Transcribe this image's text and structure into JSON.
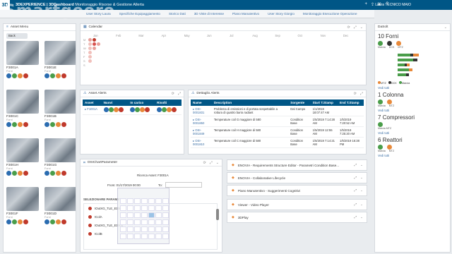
{
  "app": {
    "logo_letter": "3D",
    "title_prefix": "3DEXPERIENCE | 3DDashboard",
    "title_rest": "Monitoraggio Risorse & Gestione Allerta",
    "user": "Laura TECNICO MAIO",
    "watermark": "Smartgooro"
  },
  "tabs": [
    "Asset Menu",
    "User Story Laura",
    "Specifiche Equipaggiamento",
    "Storico Dati",
    "3D Viste di Interesse",
    "Piano Manutentivo",
    "User Story Giorgio",
    "Monitoraggio Esecuzione Operazione"
  ],
  "asset_menu": {
    "title": "Asset Menu",
    "back_label": "Back",
    "assets": [
      {
        "code": "F3001A",
        "cat": "Forni",
        "circ": [
          "b",
          "g",
          "o",
          "r"
        ]
      },
      {
        "code": "F3001E",
        "cat": "Forni",
        "circ": [
          "b",
          "g",
          "o",
          "r"
        ]
      },
      {
        "code": "F3001C",
        "cat": "Forni",
        "circ": [
          "b",
          "g",
          "o",
          "r"
        ]
      },
      {
        "code": "F3001B",
        "cat": "Forni",
        "circ": [
          "b",
          "g",
          "o",
          "r"
        ]
      },
      {
        "code": "F3001H",
        "cat": "Forni",
        "circ": [
          "b",
          "g",
          "o",
          "r"
        ]
      },
      {
        "code": "F3001G",
        "cat": "Forni",
        "circ": [
          "b",
          "g",
          "o",
          "r"
        ]
      },
      {
        "code": "F3001F",
        "cat": "Forni",
        "circ": [
          "b",
          "g",
          "o",
          "r"
        ]
      },
      {
        "code": "F3001D",
        "cat": "Forni",
        "circ": [
          "b",
          "g",
          "o",
          "r"
        ]
      }
    ]
  },
  "calendar": {
    "title": "Calendar",
    "months": [
      "Jan",
      "Feb",
      "Mar",
      "Apr",
      "May",
      "Jun",
      "Jul",
      "Aug",
      "Sep",
      "Oct",
      "Nov",
      "Dec"
    ],
    "days": [
      "M",
      "T",
      "W",
      "T",
      "F",
      "S",
      "S"
    ]
  },
  "asset_alerts": {
    "title": "Asset Alerts",
    "headers": [
      "Asset",
      "Nuovi",
      "In carico",
      "Risolti"
    ],
    "row": {
      "asset": "F1001A"
    }
  },
  "dettaglio": {
    "title": "Dettaglio Alerts",
    "headers": [
      "Name",
      "Description",
      "Sorgente",
      "Start T.Stamp",
      "End T.Stamp"
    ],
    "rows": [
      {
        "name": "OSI-0001831",
        "desc": "Problema di emissioni e di portata sospettabile a rottura di quattro barra radiant",
        "src": "Dal Campo",
        "start": "1/1/2019 18:07:47 AM",
        "end": ""
      },
      {
        "name": "OSI-0001850",
        "desc": "Temperature coil G maggiore di 580",
        "src": "Condition Base",
        "start": "1/5/2019 7:14:28 AM",
        "end": "1/5/2019 7:20:52 AM"
      },
      {
        "name": "OSI-0001849",
        "desc": "Temperature coil H maggiore di 580",
        "src": "Condition Base",
        "start": "1/5/2019 12:55 AM",
        "end": "1/5/2019 7:25:20 AM"
      },
      {
        "name": "OSI-0001810",
        "desc": "Temperature coil C maggiore di 580",
        "src": "Condition Base",
        "start": "1/5/2019 7:14:21 AM",
        "end": "1/5/2019 16:38 PM"
      }
    ]
  },
  "osi": {
    "title": "OSIChartParameter",
    "search_label": "Ricerca Asset: F3001A",
    "from_label": "From: 01/17/2019 00:00",
    "to_label": "To:",
    "section_label": "SELEZIONARE PARAMETRI",
    "params": [
      "tOutXG_TLE_E1007",
      "tColA",
      "tOutXG_TLE_E1004",
      "tColB"
    ]
  },
  "apps": [
    {
      "name": "ENOVIA - Requirements Structure Editor - Parametri Condition Base..."
    },
    {
      "name": "ENOVIA - Collaborative Lifecycle"
    },
    {
      "name": "Piano Manutentivo - Suggerimenti Cognitivi"
    },
    {
      "name": "Viewer - Video Player"
    },
    {
      "name": "3DPlay"
    }
  ],
  "sidebar": {
    "title": "DaSolt",
    "groups": [
      {
        "count": "10",
        "name": "Forni",
        "labels": [
          "Marcia",
          "DCK",
          "MTZ"
        ],
        "circ": [
          "g",
          "k",
          "o"
        ]
      },
      {
        "count": "1",
        "name": "Colonna",
        "labels": [
          "Marcia",
          "MTZ"
        ],
        "circ": [
          "g",
          "o"
        ]
      },
      {
        "count": "7",
        "name": "Compressori",
        "labels": [
          "Marcia MTZ"
        ],
        "circ": [
          "g"
        ]
      },
      {
        "count": "6",
        "name": "Reattori",
        "labels": [
          "Marcia",
          "MTZ"
        ],
        "circ": [
          "g",
          "o"
        ]
      }
    ],
    "view_all": "Vedi tutti",
    "legend": [
      "MTZ",
      "DCK",
      "Marcia"
    ]
  },
  "colors": {
    "brand": "#005686",
    "green": "#4a9d4a",
    "orange": "#e8893a",
    "red": "#c0392b",
    "blue": "#2b6cb0"
  }
}
